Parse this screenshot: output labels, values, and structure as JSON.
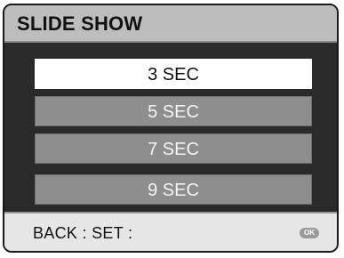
{
  "header": {
    "title": "SLIDE SHOW"
  },
  "menu": {
    "options": [
      {
        "label": "3 SEC",
        "selected": true
      },
      {
        "label": "5 SEC",
        "selected": false
      },
      {
        "label": "7 SEC",
        "selected": false
      },
      {
        "label": "9 SEC",
        "selected": false
      }
    ]
  },
  "footer": {
    "hint": "BACK : SET :",
    "ok_icon_label": "OK"
  },
  "colors": {
    "selected_bg": "#ffffff",
    "option_bg": "#8e8e8e",
    "panel_bg": "#2a2a2a",
    "title_bg": "#bdbdbd"
  },
  "icons": [
    "ok-button-icon"
  ]
}
